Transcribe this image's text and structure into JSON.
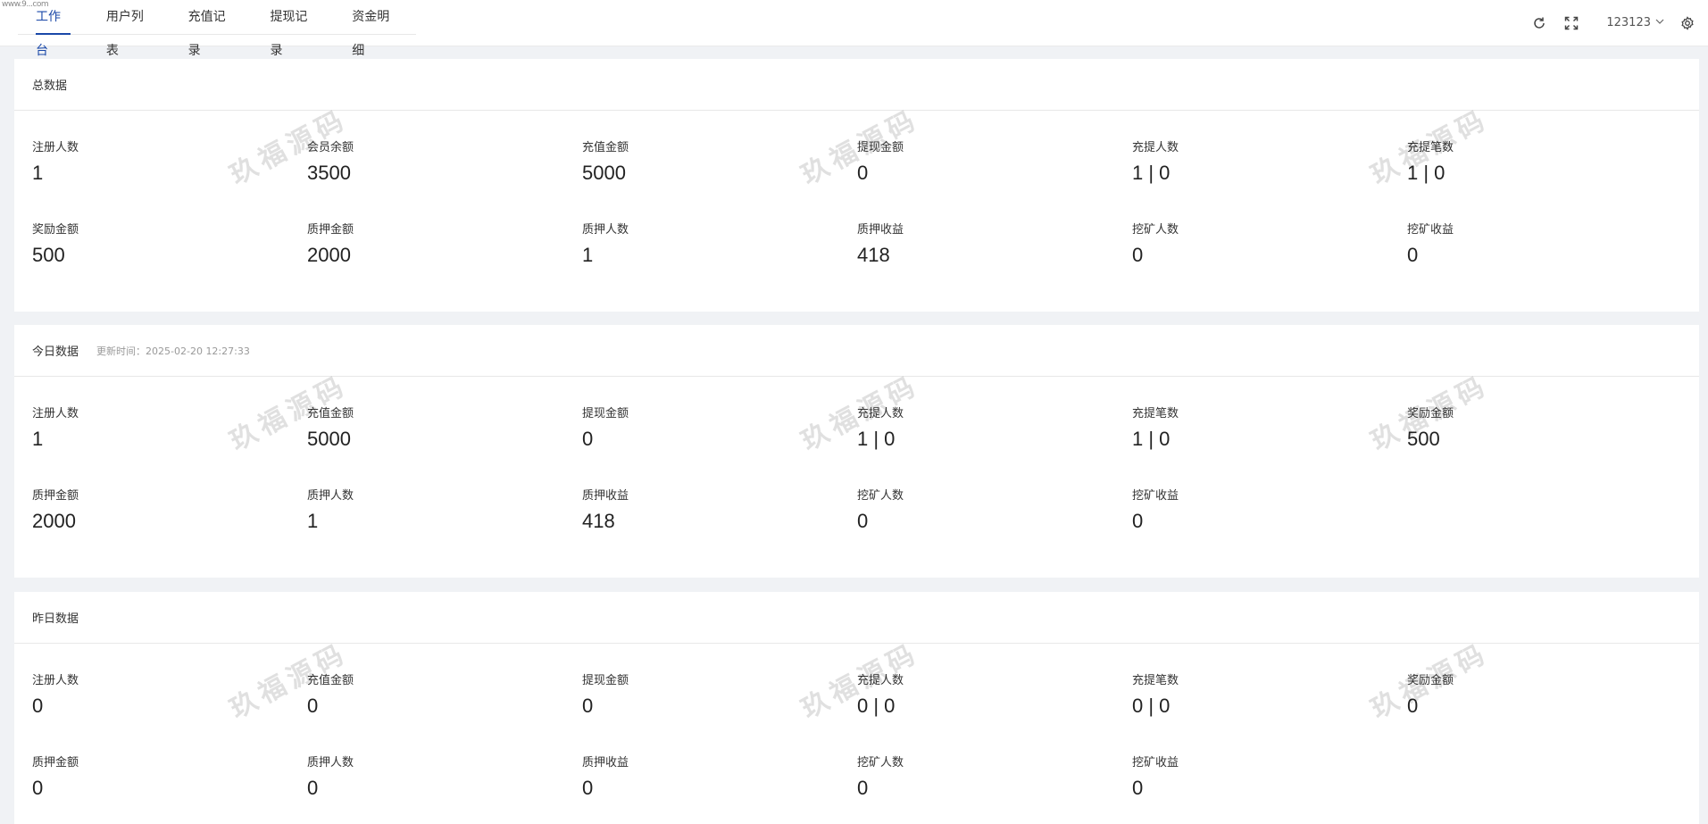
{
  "corner_text": "www.9...com",
  "tabs": [
    {
      "label": "工作台"
    },
    {
      "label": "用户列表"
    },
    {
      "label": "充值记录"
    },
    {
      "label": "提现记录"
    },
    {
      "label": "资金明细"
    }
  ],
  "header": {
    "username": "123123",
    "icons": [
      "refresh-icon",
      "fullscreen-icon",
      "settings-icon"
    ]
  },
  "total": {
    "title": "总数据",
    "stats": [
      {
        "label": "注册人数",
        "value": "1"
      },
      {
        "label": "会员余额",
        "value": "3500"
      },
      {
        "label": "充值金额",
        "value": "5000"
      },
      {
        "label": "提现金额",
        "value": "0"
      },
      {
        "label": "充提人数",
        "value": "1 | 0"
      },
      {
        "label": "充提笔数",
        "value": "1 | 0"
      },
      {
        "label": "奖励金额",
        "value": "500"
      },
      {
        "label": "质押金额",
        "value": "2000"
      },
      {
        "label": "质押人数",
        "value": "1"
      },
      {
        "label": "质押收益",
        "value": "418"
      },
      {
        "label": "挖矿人数",
        "value": "0"
      },
      {
        "label": "挖矿收益",
        "value": "0"
      }
    ]
  },
  "today": {
    "title": "今日数据",
    "update_time": "更新时间：2025-02-20 12:27:33",
    "stats": [
      {
        "label": "注册人数",
        "value": "1"
      },
      {
        "label": "充值金额",
        "value": "5000"
      },
      {
        "label": "提现金额",
        "value": "0"
      },
      {
        "label": "充提人数",
        "value": "1 | 0"
      },
      {
        "label": "充提笔数",
        "value": "1 | 0"
      },
      {
        "label": "奖励金额",
        "value": "500"
      },
      {
        "label": "质押金额",
        "value": "2000"
      },
      {
        "label": "质押人数",
        "value": "1"
      },
      {
        "label": "质押收益",
        "value": "418"
      },
      {
        "label": "挖矿人数",
        "value": "0"
      },
      {
        "label": "挖矿收益",
        "value": "0"
      }
    ]
  },
  "yesterday": {
    "title": "昨日数据",
    "stats": [
      {
        "label": "注册人数",
        "value": "0"
      },
      {
        "label": "充值金额",
        "value": "0"
      },
      {
        "label": "提现金额",
        "value": "0"
      },
      {
        "label": "充提人数",
        "value": "0 | 0"
      },
      {
        "label": "充提笔数",
        "value": "0 | 0"
      },
      {
        "label": "奖励金额",
        "value": "0"
      },
      {
        "label": "质押金额",
        "value": "0"
      },
      {
        "label": "质押人数",
        "value": "0"
      },
      {
        "label": "质押收益",
        "value": "0"
      },
      {
        "label": "挖矿人数",
        "value": "0"
      },
      {
        "label": "挖矿收益",
        "value": "0"
      }
    ]
  },
  "watermark_text": "玖福源码",
  "colors": {
    "accent": "#1a48a8",
    "background": "#f0f2f5",
    "card": "#ffffff"
  }
}
